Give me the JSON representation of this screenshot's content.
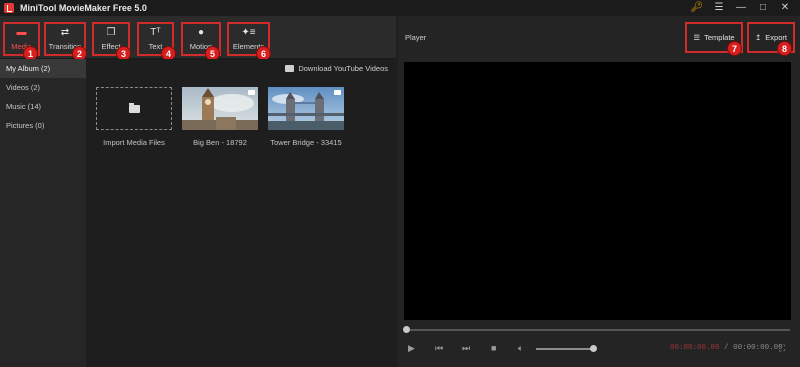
{
  "app": {
    "title": "MiniTool MovieMaker Free 5.0"
  },
  "toolbar": {
    "tabs": [
      {
        "label": "Media",
        "icon": "folder-icon",
        "badge": "1"
      },
      {
        "label": "Transition",
        "icon": "swap-arrows-icon",
        "badge": "2"
      },
      {
        "label": "Effect",
        "icon": "layers-icon",
        "badge": "3"
      },
      {
        "label": "Text",
        "icon": "text-icon",
        "badge": "4"
      },
      {
        "label": "Motion",
        "icon": "motion-icon",
        "badge": "5"
      },
      {
        "label": "Elements",
        "icon": "sparkle-icon",
        "badge": "6"
      }
    ]
  },
  "sidebar": {
    "items": [
      {
        "label": "My Album (2)"
      },
      {
        "label": "Videos (2)"
      },
      {
        "label": "Music (14)"
      },
      {
        "label": "Pictures (0)"
      }
    ]
  },
  "media": {
    "download_label": "Download YouTube Videos",
    "tiles": [
      {
        "label": "Import Media Files"
      },
      {
        "label": "Big Ben - 18792"
      },
      {
        "label": "Tower Bridge - 33415"
      }
    ]
  },
  "player": {
    "title": "Player",
    "template_label": "Template",
    "template_badge": "7",
    "export_label": "Export",
    "export_badge": "8",
    "current_time": "00:00:00.00",
    "separator": "/",
    "total_time": "00:00:00.00",
    "progress_fraction": 0,
    "volume_fraction": 1
  },
  "colors": {
    "accent": "#d12b2b",
    "active_text": "#ff4d4d",
    "time_current": "#a03434"
  }
}
